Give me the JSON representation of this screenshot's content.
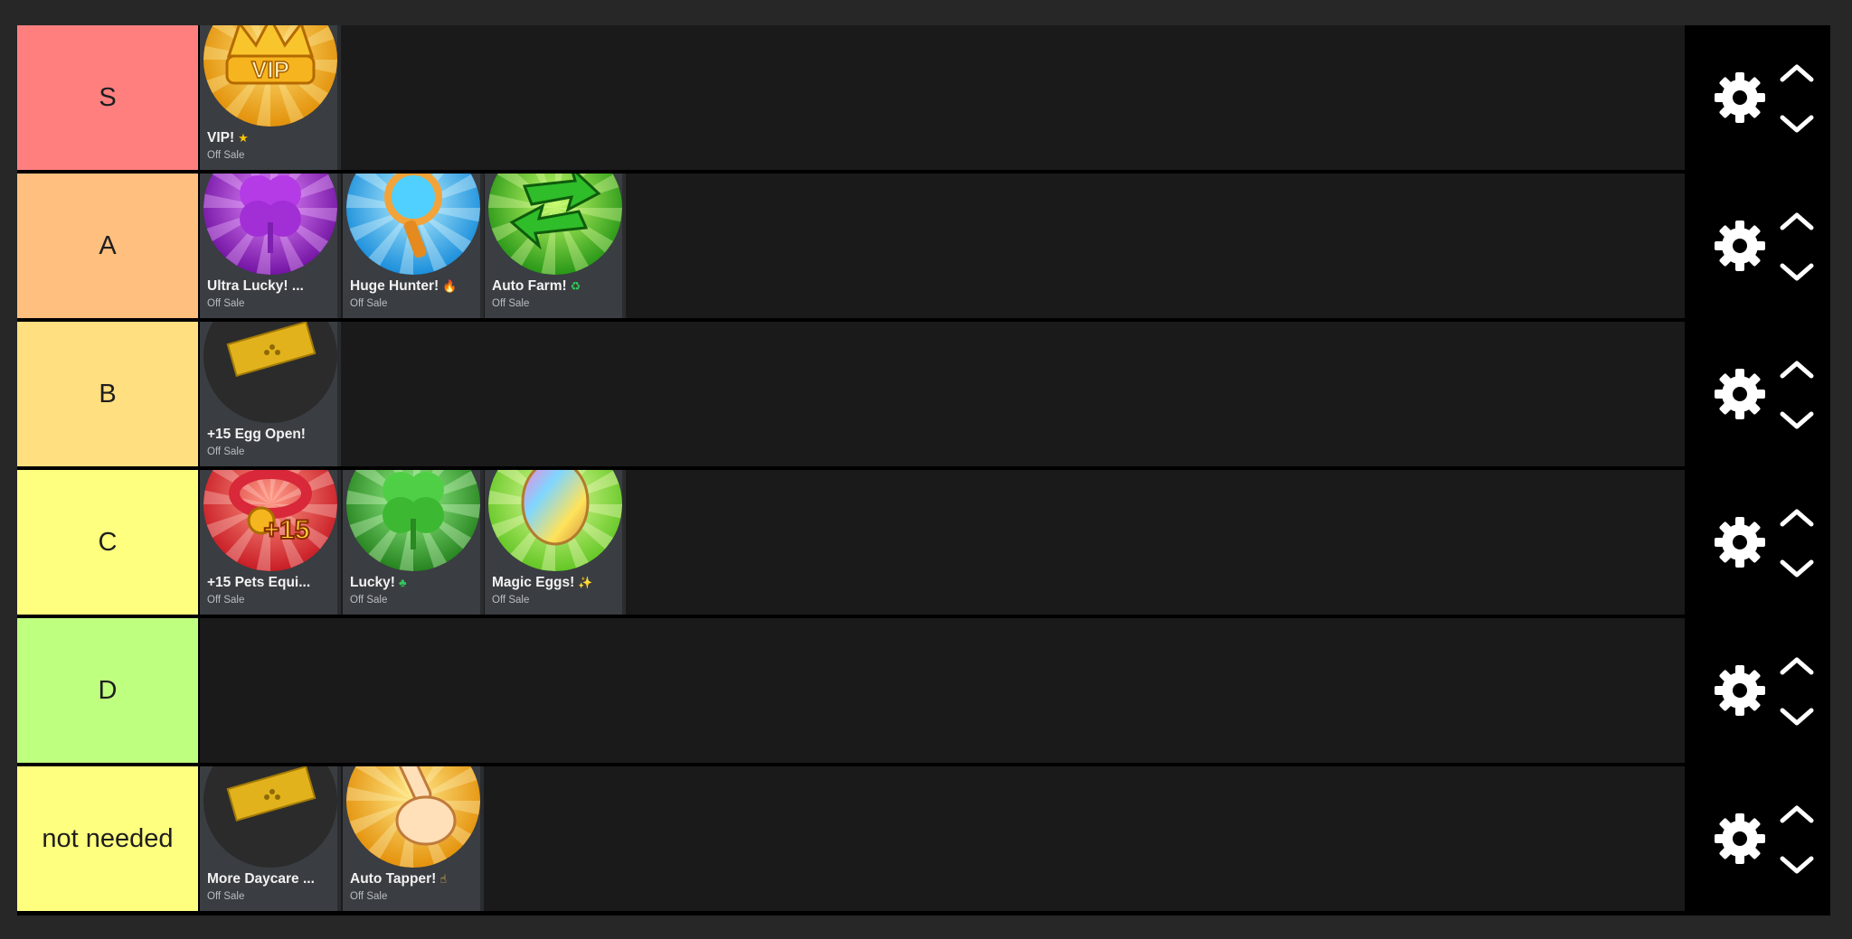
{
  "tiers": [
    {
      "label": "S",
      "color": "#ff7f7f",
      "items": [
        {
          "name": "VIP!",
          "emoji": "★",
          "emoji_color": "#f7c400",
          "status": "Off Sale",
          "icon": "vip-crown-icon"
        }
      ]
    },
    {
      "label": "A",
      "color": "#ffbf7f",
      "items": [
        {
          "name": "Ultra Lucky! ...",
          "emoji": "",
          "emoji_color": "#ffffff",
          "status": "Off Sale",
          "icon": "purple-clover-icon"
        },
        {
          "name": "Huge Hunter!",
          "emoji": "🔥",
          "emoji_color": "#ff9b1a",
          "status": "Off Sale",
          "icon": "magnifying-glass-icon"
        },
        {
          "name": "Auto Farm!",
          "emoji": "♻",
          "emoji_color": "#34c759",
          "status": "Off Sale",
          "icon": "auto-farm-arrows-icon"
        }
      ]
    },
    {
      "label": "B",
      "color": "#ffdf7f",
      "items": [
        {
          "name": "+15 Egg Open!",
          "emoji": "",
          "emoji_color": "#ffffff",
          "status": "Off Sale",
          "icon": "gold-ticket-icon"
        }
      ]
    },
    {
      "label": "C",
      "color": "#ffff7f",
      "items": [
        {
          "name": "+15 Pets Equi...",
          "emoji": "",
          "emoji_color": "#ffffff",
          "status": "Off Sale",
          "icon": "pet-collar-icon"
        },
        {
          "name": "Lucky!",
          "emoji": "♣",
          "emoji_color": "#34c759",
          "status": "Off Sale",
          "icon": "green-clover-icon"
        },
        {
          "name": "Magic Eggs!",
          "emoji": "✨",
          "emoji_color": "#ffd84a",
          "status": "Off Sale",
          "icon": "rainbow-egg-icon"
        }
      ]
    },
    {
      "label": "D",
      "color": "#bfff7f",
      "items": []
    },
    {
      "label": "not needed",
      "color": "#ffff7f",
      "items": [
        {
          "name": "More Daycare ...",
          "emoji": "",
          "emoji_color": "#ffffff",
          "status": "Off Sale",
          "icon": "gold-ticket-icon"
        },
        {
          "name": "Auto Tapper!",
          "emoji": "☝",
          "emoji_color": "#ffcc4d",
          "status": "Off Sale",
          "icon": "tapping-hand-icon"
        }
      ]
    }
  ],
  "controls": {
    "settings_icon": "gear-icon",
    "move_up_icon": "chevron-up-icon",
    "move_down_icon": "chevron-down-icon"
  }
}
